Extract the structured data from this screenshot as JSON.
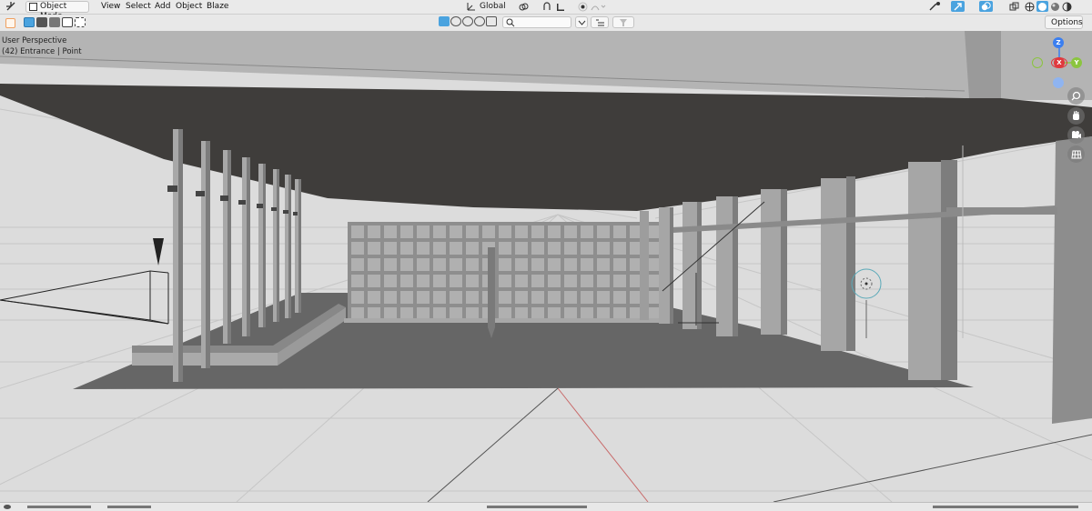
{
  "header": {
    "mode_label": "Object Mode",
    "menus": [
      "View",
      "Select",
      "Add",
      "Object",
      "Blaze"
    ],
    "orientation_label": "Global",
    "options_label": "Options",
    "search_placeholder": ""
  },
  "viewport": {
    "perspective_label": "User Perspective",
    "object_label": "(42) Entrance | Point",
    "gizmo": {
      "z": "Z",
      "x": "X",
      "y": "Y"
    }
  },
  "colors": {
    "x_axis": "#e0393e",
    "y_axis": "#8bc53f",
    "z_axis": "#3b7ff0",
    "header_bg": "#eaeaea",
    "active_blue": "#4aa3df",
    "light_teal": "#5aa9b8"
  },
  "icons": [
    "editor-type-icon",
    "object-mode-icon",
    "select-box-icon",
    "transform-orientation-icon",
    "snap-icon",
    "proportional-edit-icon",
    "visibility-icon",
    "gizmo-icon",
    "overlay-icon",
    "xray-icon",
    "shading-solid-icon",
    "zoom-icon",
    "hand-icon",
    "camera-icon",
    "grid-icon"
  ]
}
